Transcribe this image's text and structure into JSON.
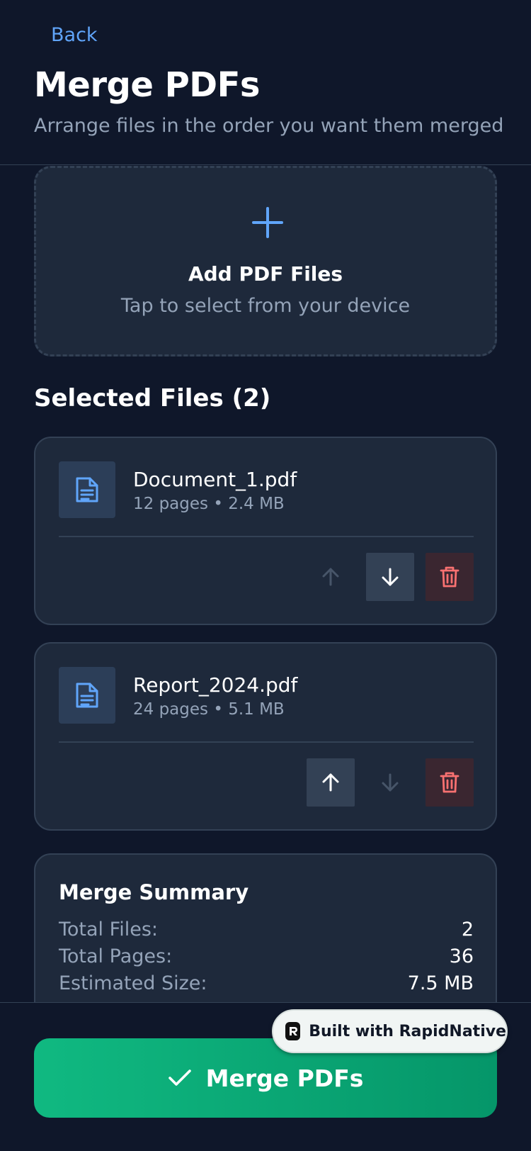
{
  "header": {
    "back_label": "Back",
    "title": "Merge PDFs",
    "subtitle": "Arrange files in the order you want them merged"
  },
  "upload": {
    "title": "Add PDF Files",
    "subtitle": "Tap to select from your device"
  },
  "files_section": {
    "title": "Selected Files (2)"
  },
  "files": [
    {
      "name": "Document_1.pdf",
      "meta": "12 pages • 2.4 MB",
      "can_move_up": false,
      "can_move_down": true
    },
    {
      "name": "Report_2024.pdf",
      "meta": "24 pages • 5.1 MB",
      "can_move_up": true,
      "can_move_down": false
    }
  ],
  "summary": {
    "title": "Merge Summary",
    "rows": [
      {
        "label": "Total Files:",
        "value": "2"
      },
      {
        "label": "Total Pages:",
        "value": "36"
      },
      {
        "label": "Estimated Size:",
        "value": "7.5 MB"
      }
    ]
  },
  "merge_button": {
    "label": "Merge PDFs"
  },
  "badge": {
    "label": "Built with RapidNative"
  },
  "icons": {
    "back": "none",
    "add": "plus-icon",
    "file": "file-text-icon",
    "move_up": "arrow-up-icon",
    "move_down": "arrow-down-icon",
    "delete": "trash-icon",
    "confirm": "check-icon",
    "brand": "rapidnative-logo-icon"
  },
  "colors": {
    "background": "#0f172a",
    "card": "#1e293b",
    "border": "#334155",
    "accent": "#60a5fa",
    "danger": "#f87171",
    "success": "#10b981",
    "muted_text": "#94a3b8"
  }
}
